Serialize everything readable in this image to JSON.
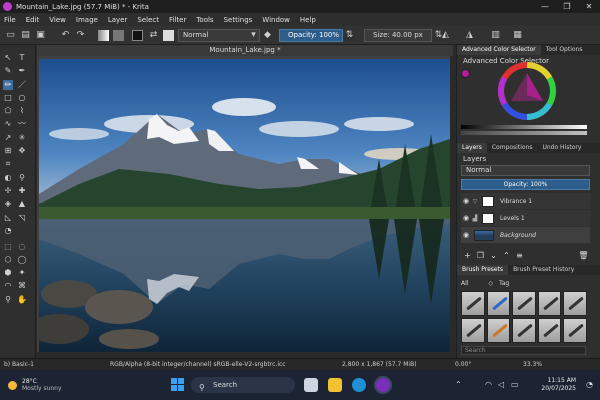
{
  "window": {
    "title": "Mountain_Lake.jpg (57.7 MiB) * - Krita",
    "controls": [
      "—",
      "❐",
      "✕"
    ]
  },
  "menu": [
    "File",
    "Edit",
    "View",
    "Image",
    "Layer",
    "Select",
    "Filter",
    "Tools",
    "Settings",
    "Window",
    "Help"
  ],
  "toolbar": {
    "blend_mode": "Normal",
    "opacity": "Opacity: 100%",
    "size": "Size: 40.00 px"
  },
  "document": {
    "tab_title": "Mountain_Lake.jpg *"
  },
  "colors": {
    "accent": "#2d5d8a",
    "wheel_selected": "#b0209a",
    "taskbar": "#1c2433"
  },
  "dock": {
    "color_tabs": [
      "Advanced Color Selector",
      "Tool Options"
    ],
    "color_title": "Advanced Color Selector",
    "layer_tabs": [
      "Layers",
      "Compositions",
      "Undo History"
    ],
    "layers_title": "Layers",
    "blend": "Normal",
    "opacity": "Opacity: 100%",
    "layers": [
      {
        "name": "Vibrance 1",
        "italic": false
      },
      {
        "name": "Levels 1",
        "italic": false
      },
      {
        "name": "Background",
        "italic": true
      }
    ],
    "brush_tabs": [
      "Brush Presets",
      "Brush Preset History"
    ],
    "brush_filter": "All",
    "brush_tag": "Tag",
    "search_placeholder": "Search"
  },
  "status": {
    "brush": "b) Basic-1",
    "color_model": "RGB/Alpha (8-bit integer/channel)  sRGB-elle-V2-srgbtrc.icc",
    "dimensions": "2,800 x 1,867 (57.7 MiB)",
    "rotation": "0.00°",
    "zoom": "33.3%"
  },
  "taskbar": {
    "temperature": "28°C",
    "weather": "Mostly sunny",
    "search": "Search",
    "time": "11:15 AM",
    "date": "20/07/2025"
  }
}
